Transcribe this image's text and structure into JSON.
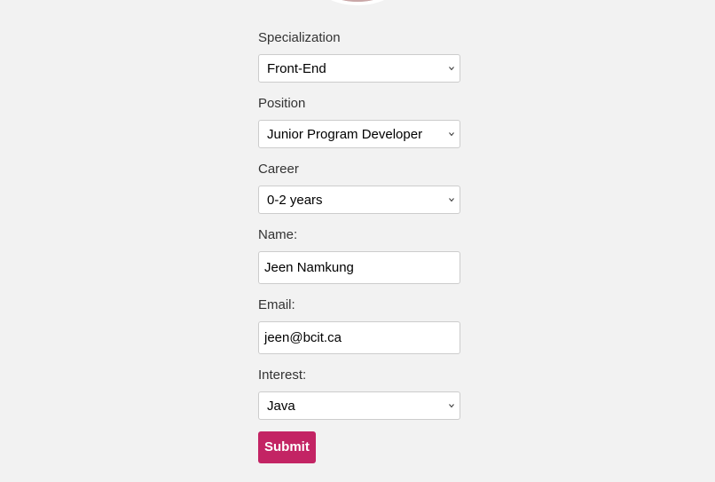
{
  "form": {
    "specialization": {
      "label": "Specialization",
      "value": "Front-End"
    },
    "position": {
      "label": "Position",
      "value": "Junior Program Developer"
    },
    "career": {
      "label": "Career",
      "value": "0-2 years"
    },
    "name": {
      "label": "Name:",
      "value": "Jeen Namkung"
    },
    "email": {
      "label": "Email:",
      "value": "jeen@bcit.ca"
    },
    "interest": {
      "label": "Interest:",
      "value": "Java"
    },
    "submit_label": "Submit"
  },
  "colors": {
    "background": "#f2f2f2",
    "submit": "#c32464",
    "text": "#333333"
  },
  "icons": {
    "select_chevron": "chevron-down-icon"
  }
}
